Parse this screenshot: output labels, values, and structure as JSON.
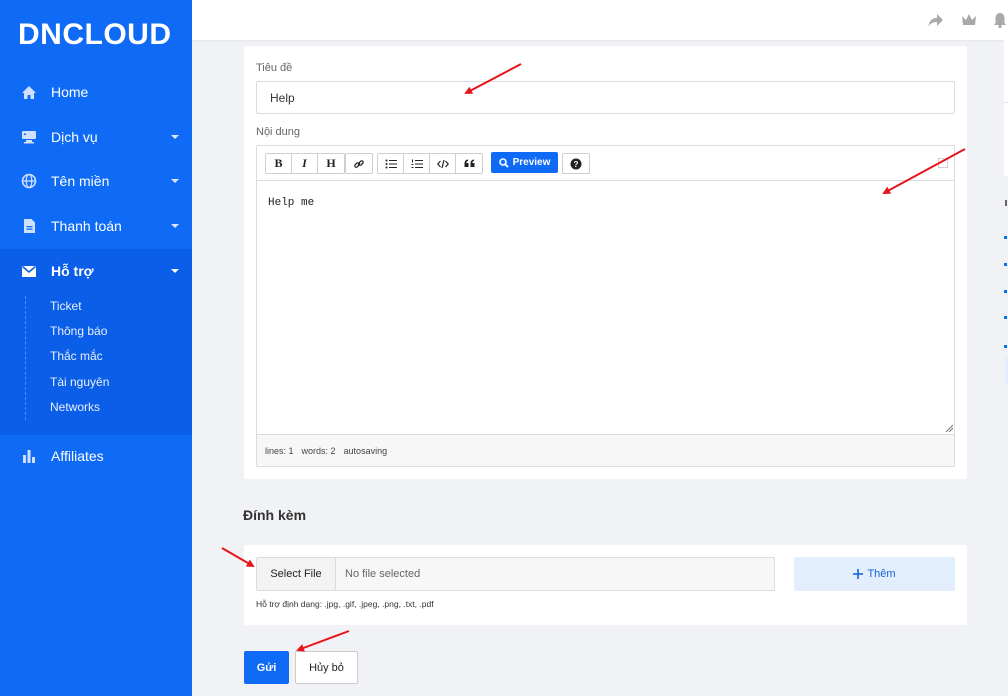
{
  "brand": {
    "logo_text": "DNCLOUD"
  },
  "sidebar": {
    "items": [
      {
        "label": "Home",
        "icon": "home-icon"
      },
      {
        "label": "Dịch vụ",
        "icon": "server-icon"
      },
      {
        "label": "Tên miền",
        "icon": "globe-icon"
      },
      {
        "label": "Thanh toán",
        "icon": "document-icon"
      },
      {
        "label": "Hỗ trợ",
        "icon": "mail-icon"
      },
      {
        "label": "Affiliates",
        "icon": "bar-chart-icon"
      }
    ],
    "support_sub": [
      "Ticket",
      "Thông báo",
      "Thắc mắc",
      "Tài nguyên",
      "Networks"
    ]
  },
  "form": {
    "title_label": "Tiêu đề",
    "title_value": "Help",
    "content_label": "Nội dung",
    "content_value": "Help me",
    "preview_label": "Preview",
    "status": {
      "lines": "lines: 1",
      "words": "words: 2",
      "autosave": "autosaving"
    }
  },
  "attachments": {
    "title": "Đính kèm",
    "select_label": "Select File",
    "no_file": "No file selected",
    "add_label": "Thêm",
    "hint": "Hỗ trợ định dạng: .jpg, .gif, .jpeg, .png, .txt, .pdf"
  },
  "actions": {
    "send": "Gửi",
    "cancel": "Hủy bỏ"
  },
  "colors": {
    "primary": "#0f6bf5",
    "sidebar_active": "#0a5ee8",
    "annotation": "#e8141b"
  }
}
